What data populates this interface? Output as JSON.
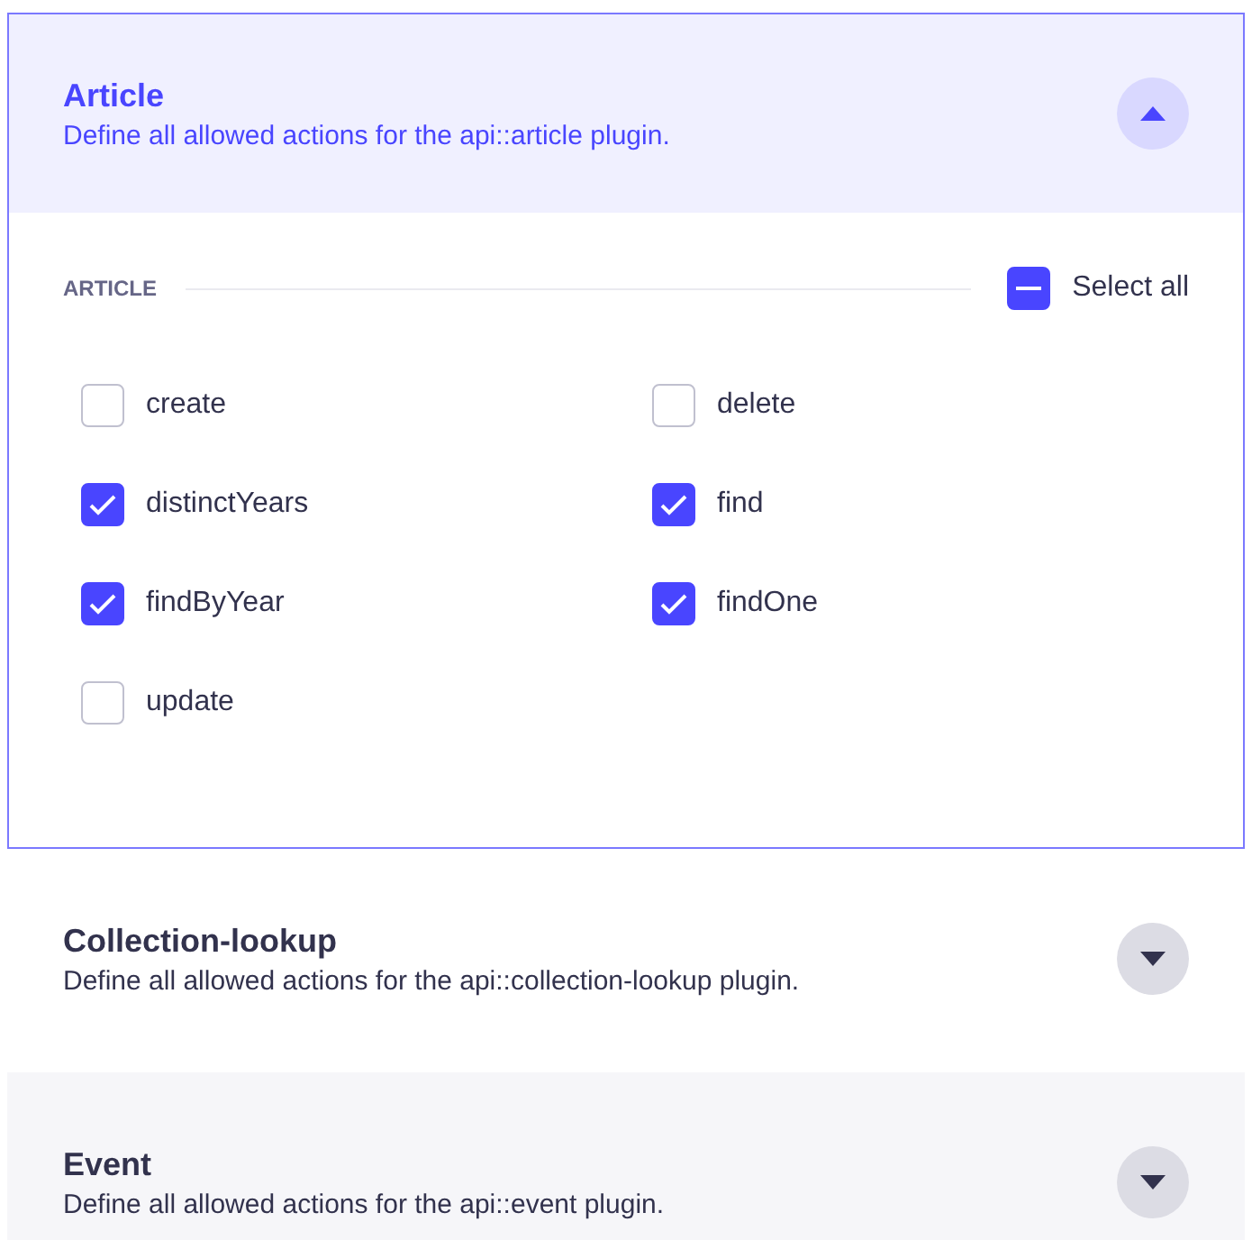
{
  "sections": [
    {
      "title": "Article",
      "description": "Define all allowed actions for the api::article plugin.",
      "expanded": true,
      "group_label": "ARTICLE",
      "select_all": {
        "label": "Select all",
        "indeterminate": true
      },
      "actions": [
        {
          "label": "create",
          "checked": false
        },
        {
          "label": "delete",
          "checked": false
        },
        {
          "label": "distinctYears",
          "checked": true
        },
        {
          "label": "find",
          "checked": true
        },
        {
          "label": "findByYear",
          "checked": true
        },
        {
          "label": "findOne",
          "checked": true
        },
        {
          "label": "update",
          "checked": false
        }
      ]
    },
    {
      "title": "Collection-lookup",
      "description": "Define all allowed actions for the api::collection-lookup plugin.",
      "expanded": false
    },
    {
      "title": "Event",
      "description": "Define all allowed actions for the api::event plugin.",
      "expanded": false
    }
  ]
}
